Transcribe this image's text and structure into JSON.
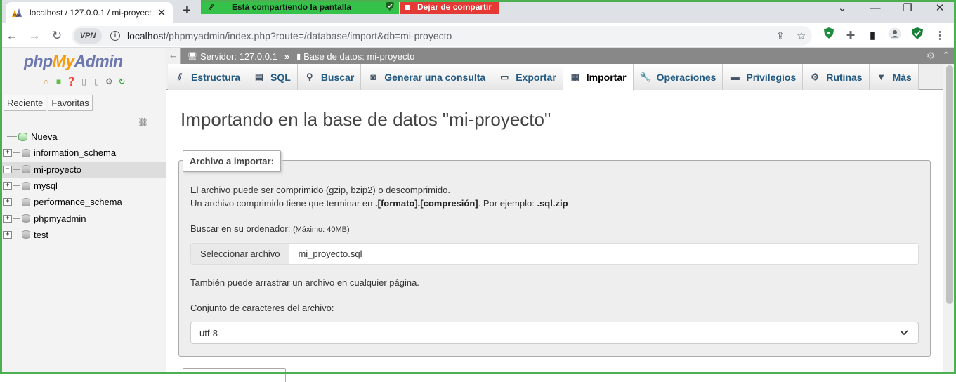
{
  "browser": {
    "tab_title": "localhost / 127.0.0.1 / mi-proyect",
    "tab_close": "✕",
    "new_tab": "+",
    "sharing_text": "Está compartiendo la pantalla",
    "stop_sharing": "Dejar de compartir",
    "vpn_label": "VPN",
    "url_host": "localhost",
    "url_path": "/phpmyadmin/index.php?route=/database/import&db=mi-proyecto",
    "accent_sharing": "#34c24a",
    "accent_stop": "#e53935"
  },
  "nav": {
    "logo_php": "php",
    "logo_my": "My",
    "logo_admin": "Admin",
    "tabs": [
      "Reciente",
      "Favoritas"
    ],
    "databases": [
      {
        "label": "Nueva",
        "type": "new"
      },
      {
        "label": "information_schema",
        "type": "db"
      },
      {
        "label": "mi-proyecto",
        "type": "db",
        "active": true
      },
      {
        "label": "mysql",
        "type": "db"
      },
      {
        "label": "performance_schema",
        "type": "db"
      },
      {
        "label": "phpmyadmin",
        "type": "db"
      },
      {
        "label": "test",
        "type": "db"
      }
    ]
  },
  "breadcrumb": {
    "server": "Servidor: 127.0.0.1",
    "separator": "»",
    "database": "Base de datos: mi-proyecto"
  },
  "menu": [
    {
      "label": "Estructura",
      "icon": "structure-icon"
    },
    {
      "label": "SQL",
      "icon": "sql-icon"
    },
    {
      "label": "Buscar",
      "icon": "search-icon"
    },
    {
      "label": "Generar una consulta",
      "icon": "query-icon"
    },
    {
      "label": "Exportar",
      "icon": "export-icon"
    },
    {
      "label": "Importar",
      "icon": "import-icon",
      "active": true
    },
    {
      "label": "Operaciones",
      "icon": "wrench-icon"
    },
    {
      "label": "Privilegios",
      "icon": "privileges-icon"
    },
    {
      "label": "Rutinas",
      "icon": "routines-icon"
    },
    {
      "label": "Más",
      "icon": "chevron-down-icon"
    }
  ],
  "main": {
    "title": "Importando en la base de datos \"mi-proyecto\"",
    "file_legend": "Archivo a importar:",
    "compress_line1": "El archivo puede ser comprimido (gzip, bzip2) o descomprimido.",
    "compress_line2_a": "Un archivo comprimido tiene que terminar en ",
    "compress_line2_b": ".[formato].[compresión]",
    "compress_line2_c": ". Por ejemplo: ",
    "compress_line2_d": ".sql.zip",
    "browse_label": "Buscar en su ordenador:",
    "max_size": "(Máximo: 40MB)",
    "select_file_button": "Seleccionar archivo",
    "selected_file": "mi_proyecto.sql",
    "drag_hint": "También puede arrastrar un archivo en cualquier página.",
    "charset_label": "Conjunto de caracteres del archivo:",
    "charset_value": "utf-8"
  }
}
